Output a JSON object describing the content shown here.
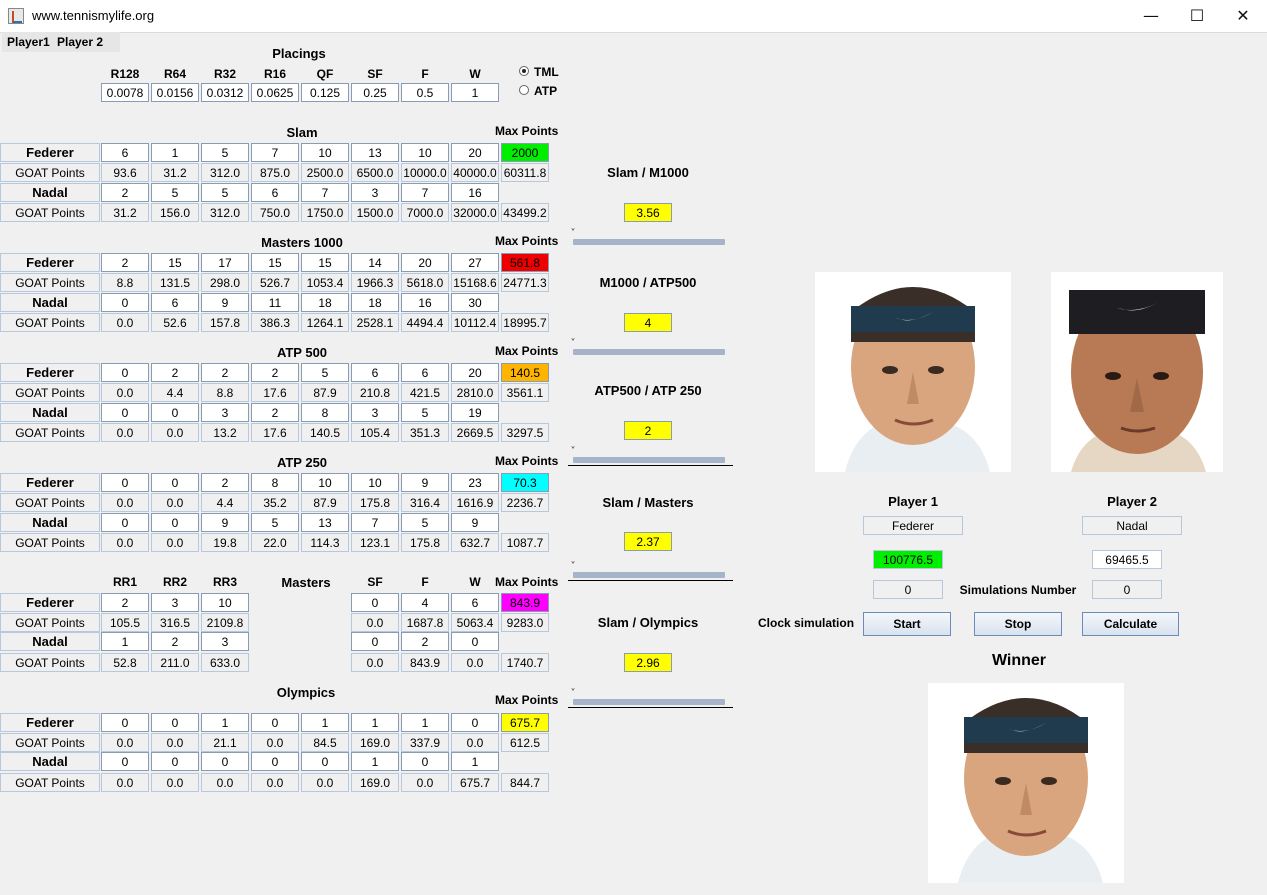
{
  "window": {
    "title": "www.tennismylife.org",
    "minimize_icon": "minimize-icon",
    "maximize_icon": "maximize-icon",
    "close_icon": "close-icon"
  },
  "menu": {
    "player1": "Player1",
    "player2": "Player 2"
  },
  "placings": {
    "title": "Placings",
    "headers": [
      "R128",
      "R64",
      "R32",
      "R16",
      "QF",
      "SF",
      "F",
      "W"
    ],
    "values": [
      "0.0078",
      "0.0156",
      "0.0312",
      "0.0625",
      "0.125",
      "0.25",
      "0.5",
      "1"
    ],
    "options": [
      "TML",
      "ATP"
    ],
    "selected": "TML"
  },
  "max_points_label": "Max Points",
  "goat_label": "GOAT Points",
  "sections": [
    {
      "title": "Slam",
      "p1": {
        "name": "Federer",
        "counts": [
          "6",
          "1",
          "5",
          "7",
          "10",
          "13",
          "10",
          "20"
        ],
        "max": "2000",
        "max_color": "#00ee00",
        "goat": [
          "93.6",
          "31.2",
          "312.0",
          "875.0",
          "2500.0",
          "6500.0",
          "10000.0",
          "40000.0"
        ],
        "total": "60311.8"
      },
      "p2": {
        "name": "Nadal",
        "counts": [
          "2",
          "5",
          "5",
          "6",
          "7",
          "3",
          "7",
          "16"
        ],
        "goat": [
          "31.2",
          "156.0",
          "312.0",
          "750.0",
          "1750.0",
          "1500.0",
          "7000.0",
          "32000.0"
        ],
        "total": "43499.2"
      }
    },
    {
      "title": "Masters 1000",
      "p1": {
        "name": "Federer",
        "counts": [
          "2",
          "15",
          "17",
          "15",
          "15",
          "14",
          "20",
          "27"
        ],
        "max": "561.8",
        "max_color": "#ee0000",
        "goat": [
          "8.8",
          "131.5",
          "298.0",
          "526.7",
          "1053.4",
          "1966.3",
          "5618.0",
          "15168.6"
        ],
        "total": "24771.3"
      },
      "p2": {
        "name": "Nadal",
        "counts": [
          "0",
          "6",
          "9",
          "11",
          "18",
          "18",
          "16",
          "30"
        ],
        "goat": [
          "0.0",
          "52.6",
          "157.8",
          "386.3",
          "1264.1",
          "2528.1",
          "4494.4",
          "10112.4"
        ],
        "total": "18995.7"
      }
    },
    {
      "title": "ATP 500",
      "p1": {
        "name": "Federer",
        "counts": [
          "0",
          "2",
          "2",
          "2",
          "5",
          "6",
          "6",
          "20"
        ],
        "max": "140.5",
        "max_color": "#ffb400",
        "goat": [
          "0.0",
          "4.4",
          "8.8",
          "17.6",
          "87.9",
          "210.8",
          "421.5",
          "2810.0"
        ],
        "total": "3561.1"
      },
      "p2": {
        "name": "Nadal",
        "counts": [
          "0",
          "0",
          "3",
          "2",
          "8",
          "3",
          "5",
          "19"
        ],
        "goat": [
          "0.0",
          "0.0",
          "13.2",
          "17.6",
          "140.5",
          "105.4",
          "351.3",
          "2669.5"
        ],
        "total": "3297.5"
      }
    },
    {
      "title": "ATP 250",
      "p1": {
        "name": "Federer",
        "counts": [
          "0",
          "0",
          "2",
          "8",
          "10",
          "10",
          "9",
          "23"
        ],
        "max": "70.3",
        "max_color": "#00ffff",
        "goat": [
          "0.0",
          "0.0",
          "4.4",
          "35.2",
          "87.9",
          "175.8",
          "316.4",
          "1616.9"
        ],
        "total": "2236.7"
      },
      "p2": {
        "name": "Nadal",
        "counts": [
          "0",
          "0",
          "9",
          "5",
          "13",
          "7",
          "5",
          "9"
        ],
        "goat": [
          "0.0",
          "0.0",
          "19.8",
          "22.0",
          "114.3",
          "123.1",
          "175.8",
          "632.7"
        ],
        "total": "1087.7"
      }
    }
  ],
  "masters": {
    "title": "Masters",
    "headers": [
      "RR1",
      "RR2",
      "RR3",
      "SF",
      "F",
      "W"
    ],
    "p1": {
      "name": "Federer",
      "rr": [
        "2",
        "3",
        "10"
      ],
      "ko": [
        "0",
        "4",
        "6"
      ],
      "max": "843.9",
      "max_color": "#ff00ff",
      "rr_goat": [
        "105.5",
        "316.5",
        "2109.8"
      ],
      "ko_goat": [
        "0.0",
        "1687.8",
        "5063.4"
      ],
      "total": "9283.0"
    },
    "p2": {
      "name": "Nadal",
      "rr": [
        "1",
        "2",
        "3"
      ],
      "ko": [
        "0",
        "2",
        "0"
      ],
      "rr_goat": [
        "52.8",
        "211.0",
        "633.0"
      ],
      "ko_goat": [
        "0.0",
        "843.9",
        "0.0"
      ],
      "total": "1740.7"
    }
  },
  "olympics": {
    "title": "Olympics",
    "p1": {
      "name": "Federer",
      "counts": [
        "0",
        "0",
        "1",
        "0",
        "1",
        "1",
        "1",
        "0"
      ],
      "max": "675.7",
      "max_color": "#ffff00",
      "goat": [
        "0.0",
        "0.0",
        "21.1",
        "0.0",
        "84.5",
        "169.0",
        "337.9",
        "0.0"
      ],
      "total": "612.5"
    },
    "p2": {
      "name": "Nadal",
      "counts": [
        "0",
        "0",
        "0",
        "0",
        "0",
        "1",
        "0",
        "1"
      ],
      "goat": [
        "0.0",
        "0.0",
        "0.0",
        "0.0",
        "0.0",
        "169.0",
        "0.0",
        "675.7"
      ],
      "total": "844.7"
    }
  },
  "ratios": [
    {
      "label": "Slam / M1000",
      "value": "3.56"
    },
    {
      "label": "M1000 / ATP500",
      "value": "4"
    },
    {
      "label": "ATP500 / ATP 250",
      "value": "2"
    },
    {
      "label": "Slam / Masters",
      "value": "2.37"
    },
    {
      "label": "Slam / Olympics",
      "value": "2.96"
    }
  ],
  "players": {
    "p1_label": "Player 1",
    "p2_label": "Player 2",
    "p1_name": "Federer",
    "p2_name": "Nadal",
    "p1_score": "100776.5",
    "p1_score_color": "#00ee00",
    "p2_score": "69465.5",
    "p1_sim": "0",
    "p2_sim": "0",
    "sim_label": "Simulations Number",
    "clock_label": "Clock simulation",
    "start": "Start",
    "stop": "Stop",
    "calculate": "Calculate",
    "winner_label": "Winner"
  }
}
